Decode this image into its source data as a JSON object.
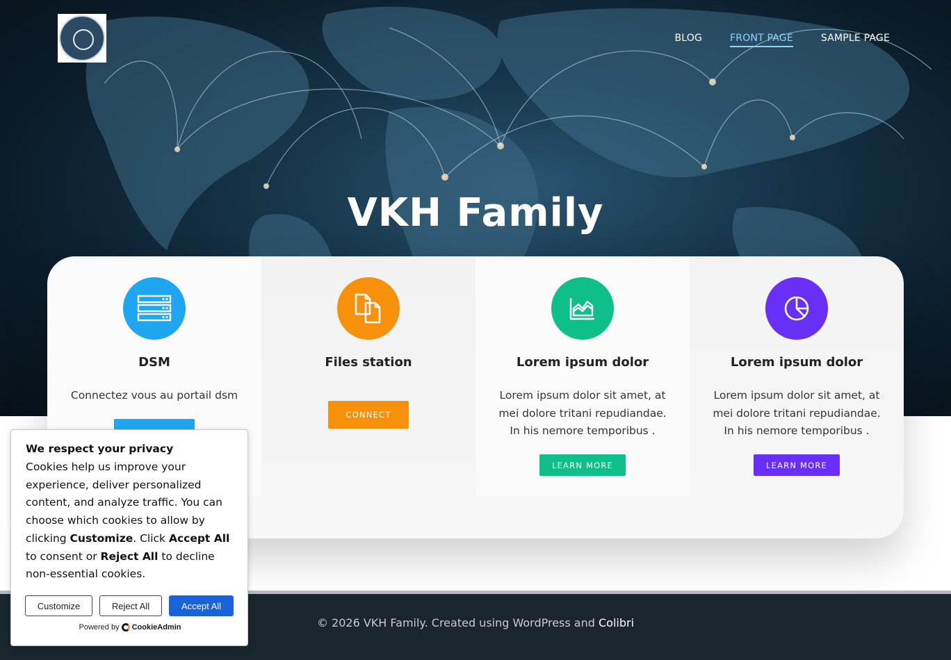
{
  "header": {
    "nav": [
      {
        "label": "BLOG"
      },
      {
        "label": "FRONT PAGE"
      },
      {
        "label": "SAMPLE PAGE"
      }
    ],
    "active_nav": "FRONT PAGE",
    "logo_icon": "family-crest-logo"
  },
  "hero": {
    "title": "VKH Family"
  },
  "features": [
    {
      "title": "DSM",
      "text": "Connectez vous au portail dsm",
      "button": "",
      "color": "#1ea7f0",
      "icon": "server-icon"
    },
    {
      "title": "Files station",
      "text": "",
      "button": "CONNECT",
      "color": "#f7900a",
      "icon": "files-icon"
    },
    {
      "title": "Lorem ipsum dolor",
      "text": "Lorem ipsum dolor sit amet, at mei dolore tritani repudiandae. In his nemore temporibus .",
      "button": "LEARN MORE",
      "color": "#0fbf8a",
      "icon": "area-chart-icon"
    },
    {
      "title": "Lorem ipsum dolor",
      "text": "Lorem ipsum dolor sit amet, at mei dolore tritani repudiandae. In his nemore temporibus .",
      "button": "LEARN MORE",
      "color": "#6a2ff7",
      "icon": "pie-chart-icon"
    }
  ],
  "footer": {
    "text": "© 2026 VKH Family. Created using WordPress and ",
    "brand": "Colibri"
  },
  "cookie": {
    "title": "We respect your privacy",
    "body_1": "Cookies help us improve your experience, deliver personalized content, and analyze traffic. You can choose which cookies to allow by clicking ",
    "bold_1": "Customize",
    "body_2": ". Click ",
    "bold_2": "Accept All",
    "body_3": " to consent or ",
    "bold_3": "Reject All",
    "body_4": " to decline non-essential cookies.",
    "customize": "Customize",
    "reject": "Reject All",
    "accept": "Accept All",
    "powered_by": "Powered by",
    "powered_brand": "CookieAdmin"
  }
}
